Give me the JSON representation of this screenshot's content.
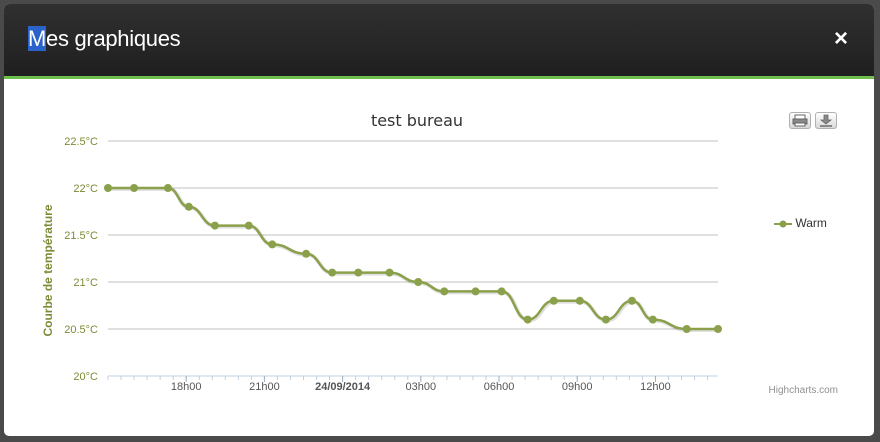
{
  "modal": {
    "title_first_letter": "M",
    "title_rest": "es graphiques",
    "close_label": "×"
  },
  "export": {
    "print_icon": "print-icon",
    "download_icon": "download-icon"
  },
  "credits": "Highcharts.com",
  "chart_data": {
    "type": "line",
    "title": "test bureau",
    "ylabel": "Courbe de température",
    "xlabel": "",
    "ylim": [
      20,
      22.5
    ],
    "yticks": [
      "20°C",
      "20.5°C",
      "21°C",
      "21.5°C",
      "22°C",
      "22.5°C"
    ],
    "ytick_values": [
      20,
      20.5,
      21,
      21.5,
      22,
      22.5
    ],
    "x_unit": "hours since first x tick reference (15h00 on 23/09/2014)",
    "xlim": [
      0,
      23.4
    ],
    "xticks": [
      {
        "label": "18h00",
        "x": 3,
        "bold": false
      },
      {
        "label": "21h00",
        "x": 6,
        "bold": false
      },
      {
        "label": "24/09/2014",
        "x": 9,
        "bold": true
      },
      {
        "label": "03h00",
        "x": 12,
        "bold": false
      },
      {
        "label": "06h00",
        "x": 15,
        "bold": false
      },
      {
        "label": "09h00",
        "x": 18,
        "bold": false
      },
      {
        "label": "12h00",
        "x": 21,
        "bold": false
      }
    ],
    "grid": true,
    "legend_position": "right",
    "series": [
      {
        "name": "Warm",
        "color": "#8aa04a",
        "x": [
          0,
          1,
          2.3,
          3.1,
          4.1,
          5.4,
          6.3,
          7.6,
          8.6,
          9.6,
          10.8,
          11.9,
          12.9,
          14.1,
          15.1,
          16.1,
          17.1,
          18.1,
          19.1,
          20.1,
          20.9,
          22.2,
          23.4
        ],
        "values": [
          22,
          22,
          22,
          21.8,
          21.6,
          21.6,
          21.4,
          21.3,
          21.1,
          21.1,
          21.1,
          21.0,
          20.9,
          20.9,
          20.9,
          20.6,
          20.8,
          20.8,
          20.6,
          20.8,
          20.6,
          20.5,
          20.5
        ]
      }
    ]
  },
  "colors": {
    "axis_label": "#7c8c35",
    "series": "#8aa04a",
    "grid": "#c0c0c0",
    "axis_line": "#c0d0e0"
  }
}
